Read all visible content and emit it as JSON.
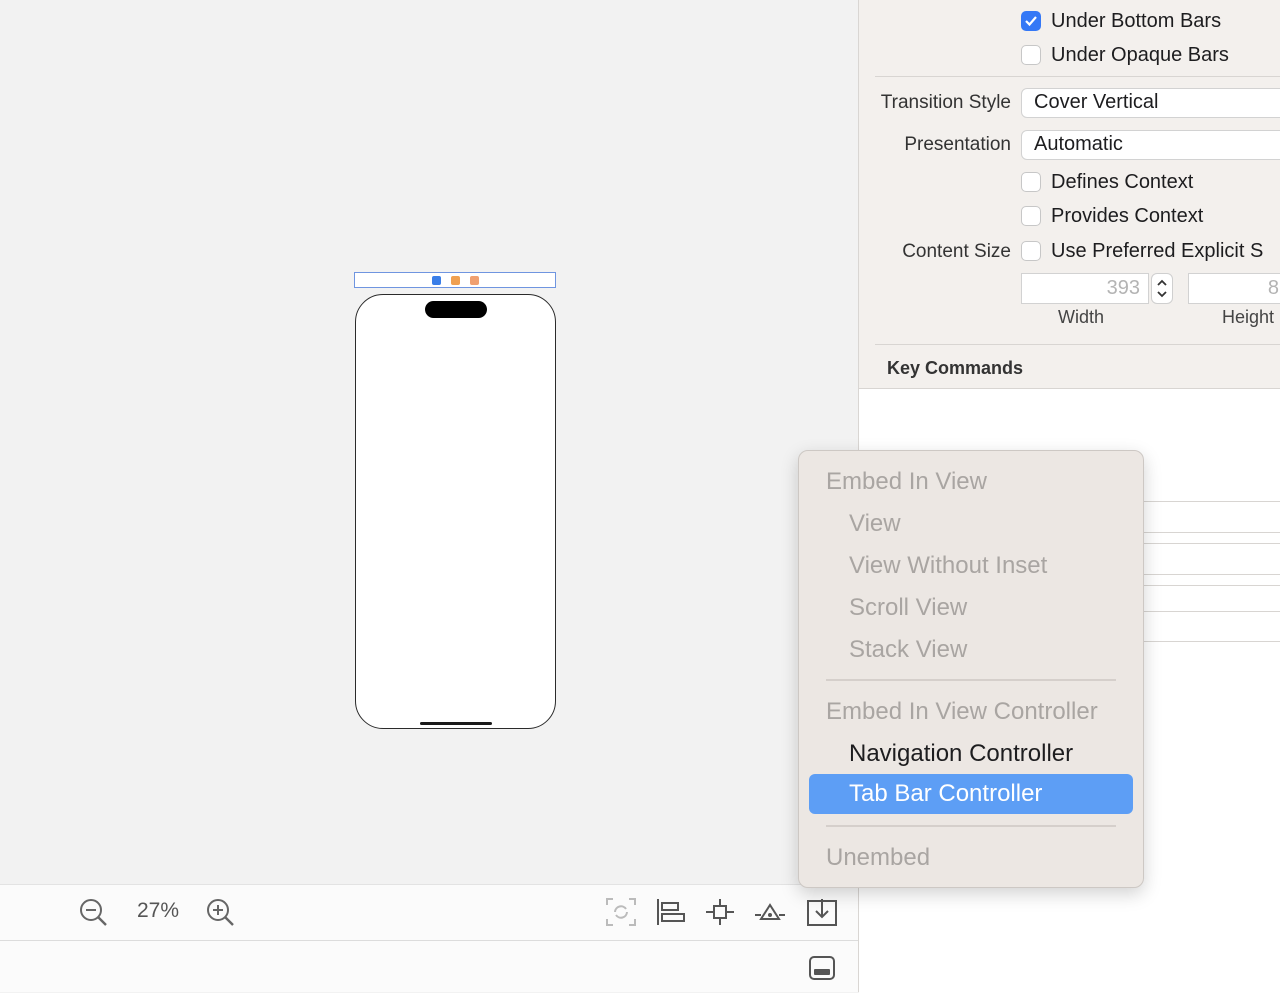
{
  "canvas": {
    "zoom_level": "27%"
  },
  "inspector": {
    "extend_edges": {
      "under_bottom_bars": {
        "label": "Under Bottom Bars",
        "checked": true
      },
      "under_opaque_bars": {
        "label": "Under Opaque Bars",
        "checked": false
      }
    },
    "transition_style": {
      "label": "Transition Style",
      "value": "Cover Vertical"
    },
    "presentation": {
      "label": "Presentation",
      "value": "Automatic"
    },
    "defines_context": {
      "label": "Defines Context",
      "checked": false
    },
    "provides_context": {
      "label": "Provides Context",
      "checked": false
    },
    "content_size": {
      "label": "Content Size",
      "option_label": "Use Preferred Explicit S",
      "checked": false,
      "width_value": "393",
      "width_label": "Width",
      "height_value": "8",
      "height_label": "Height"
    },
    "key_commands_title": "Key Commands"
  },
  "menu": {
    "embed_in_view_header": "Embed In View",
    "items_view": [
      "View",
      "View Without Inset",
      "Scroll View",
      "Stack View"
    ],
    "embed_in_vc_header": "Embed In View Controller",
    "navigation_controller": "Navigation Controller",
    "tab_bar_controller": "Tab Bar Controller",
    "unembed": "Unembed"
  },
  "colors": {
    "accent": "#3478f6",
    "menu_highlight": "#5d9ef5",
    "menu_background": "#ece7e3"
  }
}
